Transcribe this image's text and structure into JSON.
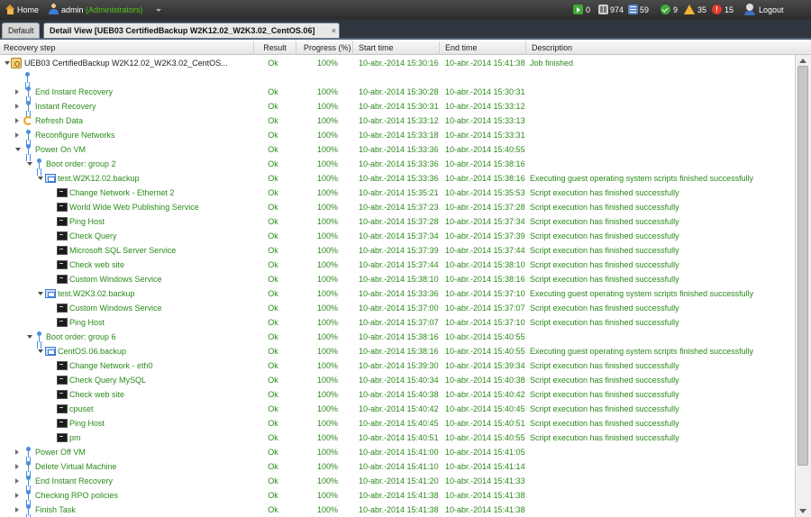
{
  "topbar": {
    "home_label": "Home",
    "user_name": "admin",
    "user_role": "(Administrators)",
    "running_count": "0",
    "storage_count": "974",
    "jobs_count": "59",
    "ok_count": "9",
    "warning_count": "35",
    "error_count": "15",
    "logout_label": "Logout"
  },
  "tabs": {
    "default_label": "Default",
    "detail_label": "Detail View [UEB03 CertifiedBackup W2K12.02_W2K3.02_CentOS.06]",
    "close_glyph": "×"
  },
  "grid": {
    "columns": [
      "Recovery step",
      "Result",
      "Progress (%)",
      "Start time",
      "End time",
      "Description"
    ],
    "rows": [
      {
        "name": "UEB03 CertifiedBackup W2K12.02_W2K3.02_CentOS...",
        "level": 0,
        "icon": "job-icon",
        "expander": "expanded",
        "result": "Ok",
        "progress": "100%",
        "start": "10-abr.-2014 15:30:16",
        "end": "10-abr.-2014 15:41:38",
        "description": "Job finished"
      },
      {
        "name": "",
        "level": 1,
        "icon": "step-icon",
        "expander": "",
        "result": "",
        "progress": "",
        "start": "",
        "end": "",
        "description": ""
      },
      {
        "name": "End Instant Recovery",
        "level": 1,
        "icon": "step-icon",
        "expander": "collapsed",
        "result": "Ok",
        "progress": "100%",
        "start": "10-abr.-2014 15:30:28",
        "end": "10-abr.-2014 15:30:31",
        "description": ""
      },
      {
        "name": "Instant Recovery",
        "level": 1,
        "icon": "step-icon",
        "expander": "collapsed",
        "result": "Ok",
        "progress": "100%",
        "start": "10-abr.-2014 15:30:31",
        "end": "10-abr.-2014 15:33:12",
        "description": ""
      },
      {
        "name": "Refresh Data",
        "level": 1,
        "icon": "refresh-icon",
        "expander": "collapsed",
        "result": "Ok",
        "progress": "100%",
        "start": "10-abr.-2014 15:33:12",
        "end": "10-abr.-2014 15:33:13",
        "description": ""
      },
      {
        "name": "Reconfigure Networks",
        "level": 1,
        "icon": "step-icon",
        "expander": "collapsed",
        "result": "Ok",
        "progress": "100%",
        "start": "10-abr.-2014 15:33:18",
        "end": "10-abr.-2014 15:33:31",
        "description": ""
      },
      {
        "name": "Power On VM",
        "level": 1,
        "icon": "step-icon",
        "expander": "expanded",
        "result": "Ok",
        "progress": "100%",
        "start": "10-abr.-2014 15:33:36",
        "end": "10-abr.-2014 15:40:55",
        "description": ""
      },
      {
        "name": "Boot order: group 2",
        "level": 2,
        "icon": "step-icon",
        "expander": "expanded",
        "result": "Ok",
        "progress": "100%",
        "start": "10-abr.-2014 15:33:36",
        "end": "10-abr.-2014 15:38:16",
        "description": ""
      },
      {
        "name": "test.W2K12.02.backup",
        "level": 3,
        "icon": "vm-icon",
        "expander": "expanded",
        "result": "Ok",
        "progress": "100%",
        "start": "10-abr.-2014 15:33:36",
        "end": "10-abr.-2014 15:38:16",
        "description": "Executing guest operating system scripts finished successfully"
      },
      {
        "name": "Change Network - Ethernet 2",
        "level": 4,
        "icon": "terminal-icon",
        "expander": "",
        "result": "Ok",
        "progress": "100%",
        "start": "10-abr.-2014 15:35:21",
        "end": "10-abr.-2014 15:35:53",
        "description": "Script execution has finished successfully"
      },
      {
        "name": "World Wide Web Publishing Service",
        "level": 4,
        "icon": "terminal-icon",
        "expander": "",
        "result": "Ok",
        "progress": "100%",
        "start": "10-abr.-2014 15:37:23",
        "end": "10-abr.-2014 15:37:28",
        "description": "Script execution has finished successfully"
      },
      {
        "name": "Ping Host",
        "level": 4,
        "icon": "terminal-icon",
        "expander": "",
        "result": "Ok",
        "progress": "100%",
        "start": "10-abr.-2014 15:37:28",
        "end": "10-abr.-2014 15:37:34",
        "description": "Script execution has finished successfully"
      },
      {
        "name": "Check Query",
        "level": 4,
        "icon": "terminal-icon",
        "expander": "",
        "result": "Ok",
        "progress": "100%",
        "start": "10-abr.-2014 15:37:34",
        "end": "10-abr.-2014 15:37:39",
        "description": "Script execution has finished successfully"
      },
      {
        "name": "Microsoft SQL Server Service",
        "level": 4,
        "icon": "terminal-icon",
        "expander": "",
        "result": "Ok",
        "progress": "100%",
        "start": "10-abr.-2014 15:37:39",
        "end": "10-abr.-2014 15:37:44",
        "description": "Script execution has finished successfully"
      },
      {
        "name": "Check web site",
        "level": 4,
        "icon": "terminal-icon",
        "expander": "",
        "result": "Ok",
        "progress": "100%",
        "start": "10-abr.-2014 15:37:44",
        "end": "10-abr.-2014 15:38:10",
        "description": "Script execution has finished successfully"
      },
      {
        "name": "Custom Windows Service",
        "level": 4,
        "icon": "terminal-icon",
        "expander": "",
        "result": "Ok",
        "progress": "100%",
        "start": "10-abr.-2014 15:38:10",
        "end": "10-abr.-2014 15:38:16",
        "description": "Script execution has finished successfully"
      },
      {
        "name": "test.W2K3.02.backup",
        "level": 3,
        "icon": "vm-icon",
        "expander": "expanded",
        "result": "Ok",
        "progress": "100%",
        "start": "10-abr.-2014 15:33:36",
        "end": "10-abr.-2014 15:37:10",
        "description": "Executing guest operating system scripts finished successfully"
      },
      {
        "name": "Custom Windows Service",
        "level": 4,
        "icon": "terminal-icon",
        "expander": "",
        "result": "Ok",
        "progress": "100%",
        "start": "10-abr.-2014 15:37:00",
        "end": "10-abr.-2014 15:37:07",
        "description": "Script execution has finished successfully"
      },
      {
        "name": "Ping Host",
        "level": 4,
        "icon": "terminal-icon",
        "expander": "",
        "result": "Ok",
        "progress": "100%",
        "start": "10-abr.-2014 15:37:07",
        "end": "10-abr.-2014 15:37:10",
        "description": "Script execution has finished successfully"
      },
      {
        "name": "Boot order: group 6",
        "level": 2,
        "icon": "step-icon",
        "expander": "expanded",
        "result": "Ok",
        "progress": "100%",
        "start": "10-abr.-2014 15:38:16",
        "end": "10-abr.-2014 15:40:55",
        "description": ""
      },
      {
        "name": "CentOS.06.backup",
        "level": 3,
        "icon": "vm-icon",
        "expander": "expanded",
        "result": "Ok",
        "progress": "100%",
        "start": "10-abr.-2014 15:38:16",
        "end": "10-abr.-2014 15:40:55",
        "description": "Executing guest operating system scripts finished successfully"
      },
      {
        "name": "Change Network - eth0",
        "level": 4,
        "icon": "terminal-icon",
        "expander": "",
        "result": "Ok",
        "progress": "100%",
        "start": "10-abr.-2014 15:39:30",
        "end": "10-abr.-2014 15:39:34",
        "description": "Script execution has finished successfully"
      },
      {
        "name": "Check Query MySQL",
        "level": 4,
        "icon": "terminal-icon",
        "expander": "",
        "result": "Ok",
        "progress": "100%",
        "start": "10-abr.-2014 15:40:34",
        "end": "10-abr.-2014 15:40:38",
        "description": "Script execution has finished successfully"
      },
      {
        "name": "Check web site",
        "level": 4,
        "icon": "terminal-icon",
        "expander": "",
        "result": "Ok",
        "progress": "100%",
        "start": "10-abr.-2014 15:40:38",
        "end": "10-abr.-2014 15:40:42",
        "description": "Script execution has finished successfully"
      },
      {
        "name": "cpuset",
        "level": 4,
        "icon": "terminal-icon",
        "expander": "",
        "result": "Ok",
        "progress": "100%",
        "start": "10-abr.-2014 15:40:42",
        "end": "10-abr.-2014 15:40:45",
        "description": "Script execution has finished successfully"
      },
      {
        "name": "Ping Host",
        "level": 4,
        "icon": "terminal-icon",
        "expander": "",
        "result": "Ok",
        "progress": "100%",
        "start": "10-abr.-2014 15:40:45",
        "end": "10-abr.-2014 15:40:51",
        "description": "Script execution has finished successfully"
      },
      {
        "name": "pm",
        "level": 4,
        "icon": "terminal-icon",
        "expander": "",
        "result": "Ok",
        "progress": "100%",
        "start": "10-abr.-2014 15:40:51",
        "end": "10-abr.-2014 15:40:55",
        "description": "Script execution has finished successfully"
      },
      {
        "name": "Power Off VM",
        "level": 1,
        "icon": "step-icon",
        "expander": "collapsed",
        "result": "Ok",
        "progress": "100%",
        "start": "10-abr.-2014 15:41:00",
        "end": "10-abr.-2014 15:41:05",
        "description": ""
      },
      {
        "name": "Delete Virtual Machine",
        "level": 1,
        "icon": "step-icon",
        "expander": "collapsed",
        "result": "Ok",
        "progress": "100%",
        "start": "10-abr.-2014 15:41:10",
        "end": "10-abr.-2014 15:41:14",
        "description": ""
      },
      {
        "name": "End Instant Recovery",
        "level": 1,
        "icon": "step-icon",
        "expander": "collapsed",
        "result": "Ok",
        "progress": "100%",
        "start": "10-abr.-2014 15:41:20",
        "end": "10-abr.-2014 15:41:33",
        "description": ""
      },
      {
        "name": "Checking RPO policies",
        "level": 1,
        "icon": "step-icon",
        "expander": "collapsed",
        "result": "Ok",
        "progress": "100%",
        "start": "10-abr.-2014 15:41:38",
        "end": "10-abr.-2014 15:41:38",
        "description": ""
      },
      {
        "name": "Finish Task",
        "level": 1,
        "icon": "step-icon",
        "expander": "collapsed",
        "result": "Ok",
        "progress": "100%",
        "start": "10-abr.-2014 15:41:38",
        "end": "10-abr.-2014 15:41:38",
        "description": ""
      }
    ]
  }
}
